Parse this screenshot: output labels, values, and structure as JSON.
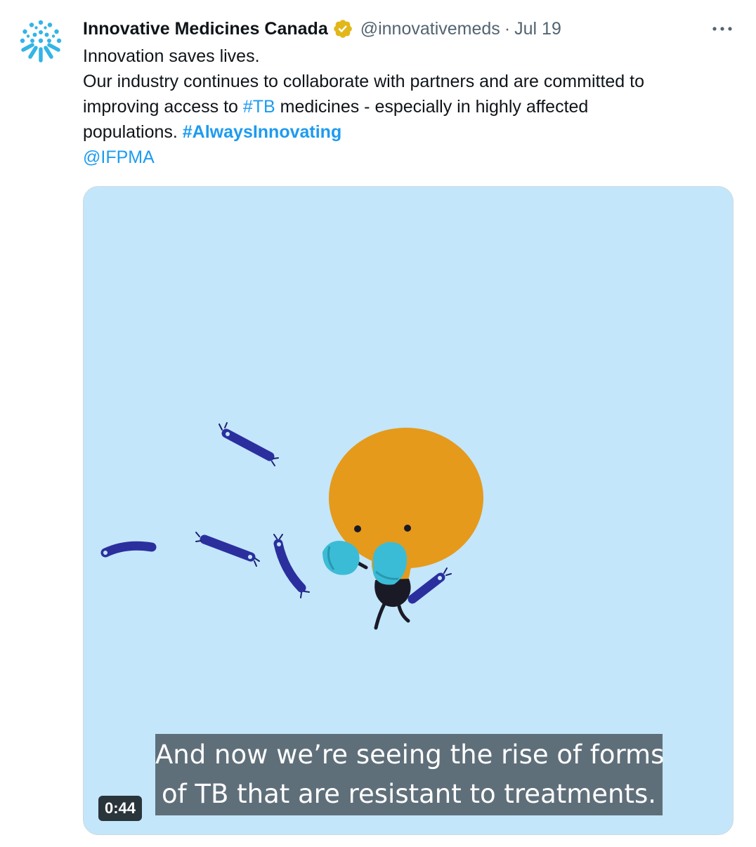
{
  "author": {
    "display_name": "Innovative Medicines Canada",
    "handle": "@innovativemeds",
    "separator": "·",
    "date": "Jul 19",
    "avatar_icon": "sunburst-logo-icon",
    "verified_icon": "verified-badge-icon",
    "brand_color": "#33b5e5"
  },
  "tweet": {
    "line1": "Innovation saves lives.",
    "line2": "Our industry continues to collaborate with partners and are committed to",
    "line3_a": "improving access to ",
    "line3_hashtag": "#TB",
    "line3_b": " medicines - especially in highly affected",
    "line4_a": "populations. ",
    "line4_hashtag": "#AlwaysInnovating",
    "mention": "@IFPMA",
    "link_color": "#1d9bf0"
  },
  "more_button_icon": "more-options-icon",
  "video": {
    "caption_line1": "And now we’re seeing the rise of forms",
    "caption_line2": "of TB that are resistant to treatments.",
    "duration": "0:44",
    "background_color": "#c3e6fb"
  }
}
